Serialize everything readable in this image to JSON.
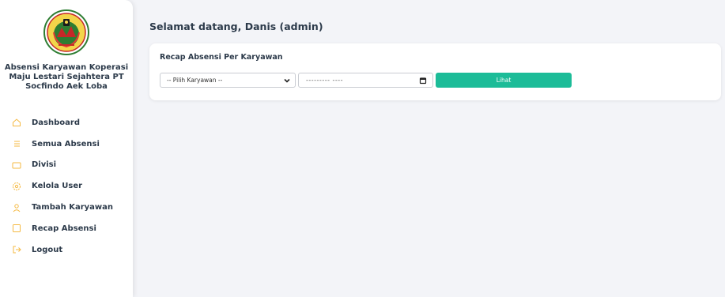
{
  "sidebar": {
    "logo_icon": "cooperative-seal-logo",
    "brand_title": "Absensi Karyawan Koperasi Maju Lestari Sejahtera PT Socfindo Aek Loba",
    "items": [
      {
        "label": "Dashboard",
        "icon": "home-icon"
      },
      {
        "label": "Semua Absensi",
        "icon": "list-icon"
      },
      {
        "label": "Divisi",
        "icon": "folder-icon"
      },
      {
        "label": "Kelola User",
        "icon": "gear-icon"
      },
      {
        "label": "Tambah Karyawan",
        "icon": "user-icon"
      },
      {
        "label": "Recap Absensi",
        "icon": "square-icon"
      },
      {
        "label": "Logout",
        "icon": "logout-icon"
      }
    ],
    "icon_color": "#f5b942"
  },
  "header": {
    "welcome": "Selamat datang, Danis (admin)"
  },
  "recap": {
    "title": "Recap Absensi Per Karyawan",
    "employee_select": "-- Pilih Karyawan --",
    "date_value": "--------- ----",
    "submit_label": "Lihat",
    "accent": "#1cbc98"
  }
}
